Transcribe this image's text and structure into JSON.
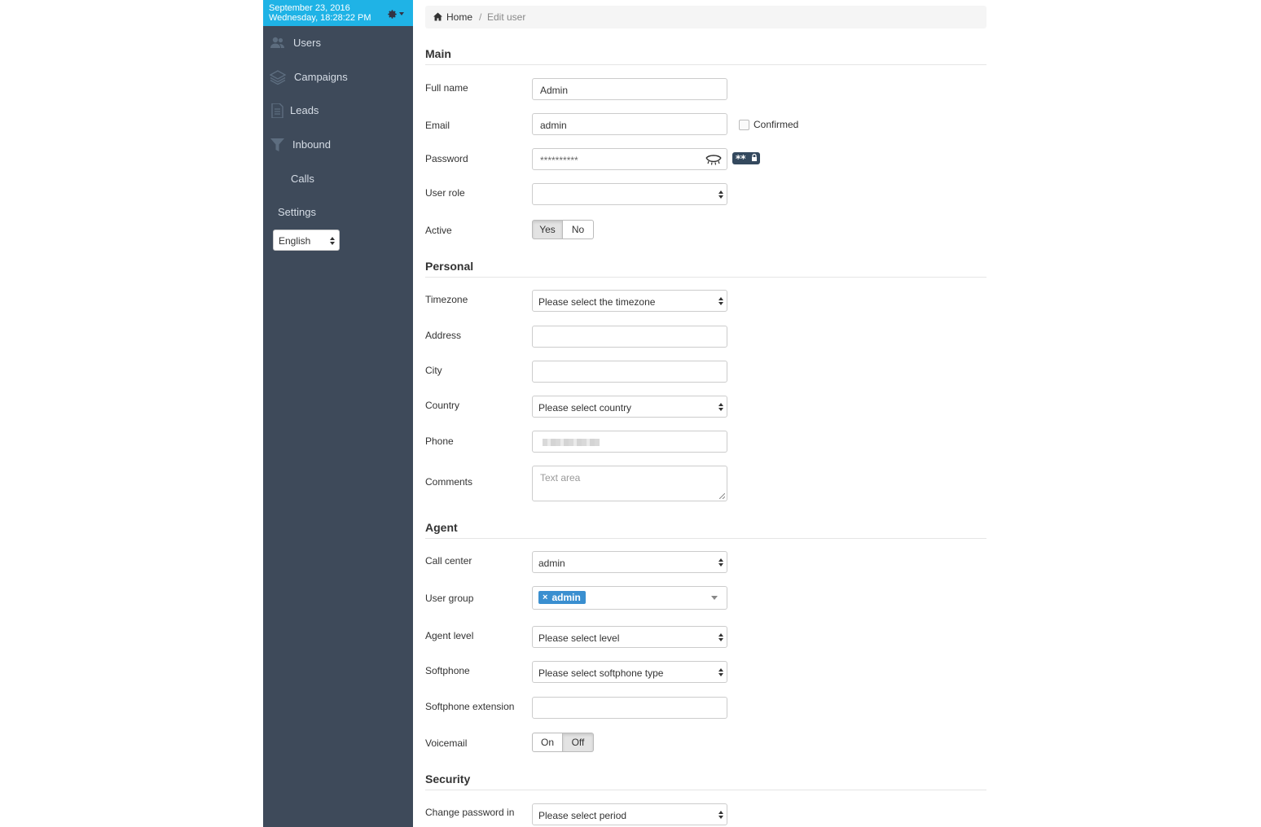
{
  "sidebar": {
    "date": "September 23, 2016",
    "time": "Wednesday, 18:28:22 PM",
    "nav": {
      "users": "Users",
      "campaigns": "Campaigns",
      "leads": "Leads",
      "inbound": "Inbound",
      "calls": "Calls",
      "settings": "Settings"
    },
    "language": "English"
  },
  "breadcrumb": {
    "home": "Home",
    "separator": "/",
    "current": "Edit user"
  },
  "sections": {
    "main": "Main",
    "personal": "Personal",
    "agent": "Agent",
    "security": "Security"
  },
  "fields": {
    "full_name": {
      "label": "Full name",
      "value": "Admin"
    },
    "email": {
      "label": "Email",
      "value": "admin",
      "confirmed_label": "Confirmed",
      "confirmed": false
    },
    "password": {
      "label": "Password",
      "value": "**********"
    },
    "user_role": {
      "label": "User role",
      "value": ""
    },
    "active": {
      "label": "Active",
      "yes": "Yes",
      "no": "No",
      "selected": "Yes"
    },
    "timezone": {
      "label": "Timezone",
      "value": "Please select the timezone"
    },
    "address": {
      "label": "Address",
      "value": ""
    },
    "city": {
      "label": "City",
      "value": ""
    },
    "country": {
      "label": "Country",
      "value": "Please select country"
    },
    "phone": {
      "label": "Phone"
    },
    "comments": {
      "label": "Comments",
      "placeholder": "Text area"
    },
    "call_center": {
      "label": "Call center",
      "value": "admin"
    },
    "user_group": {
      "label": "User group",
      "tag": "admin",
      "remove": "×"
    },
    "agent_level": {
      "label": "Agent level",
      "value": "Please select level"
    },
    "softphone": {
      "label": "Softphone",
      "value": "Please select softphone type"
    },
    "softphone_extension": {
      "label": "Softphone extension",
      "value": ""
    },
    "voicemail": {
      "label": "Voicemail",
      "on": "On",
      "off": "Off",
      "selected": "Off"
    },
    "change_password_in": {
      "label": "Change password in",
      "value": "Please select period"
    }
  },
  "colors": {
    "sidebar_bg": "#3e4a5a",
    "header_accent": "#1fb3e6",
    "tag_blue": "#3a8fd0"
  },
  "icons": {
    "users": "users-icon",
    "campaigns": "layers-icon",
    "leads": "document-icon",
    "inbound": "funnel-icon",
    "gear": "gear-icon",
    "home": "home-icon",
    "eye": "eye-icon",
    "password_strength": "password-badge-icon"
  }
}
